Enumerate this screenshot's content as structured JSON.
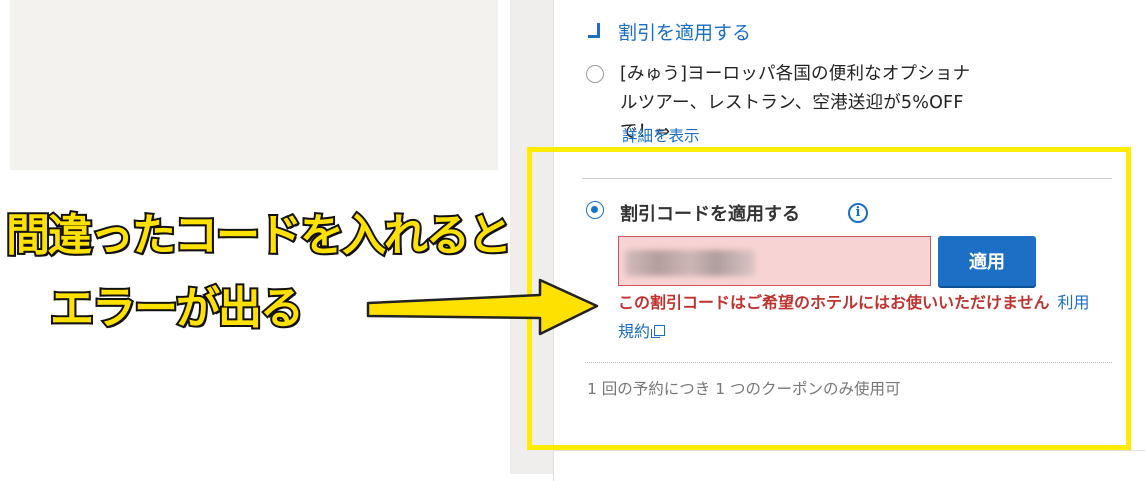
{
  "header": {
    "apply_discount": "割引を適用する"
  },
  "offer": {
    "text": "[みゅう]ヨーロッパ各国の便利なオプショナルツアー、レストラン、空港送迎が5%OFFで！⇒",
    "detail_link": "詳細を表示",
    "selected": false
  },
  "coupon": {
    "label": "割引コードを適用する",
    "info_icon": "i",
    "input_value": "",
    "apply_label": "適用",
    "error_message": "この割引コードはご希望のホテルにはお使いいただけません",
    "terms_link": "利用規約",
    "note": "1 回の予約につき 1 つのクーポンのみ使用可",
    "selected": true
  },
  "annotation": {
    "line1": "間違ったコードを入れると",
    "line2": "エラーが出る"
  },
  "colors": {
    "highlight": "#ffec00",
    "accent": "#1d6fc6",
    "error": "#c0322e",
    "error_bg": "#f8d3d3"
  }
}
